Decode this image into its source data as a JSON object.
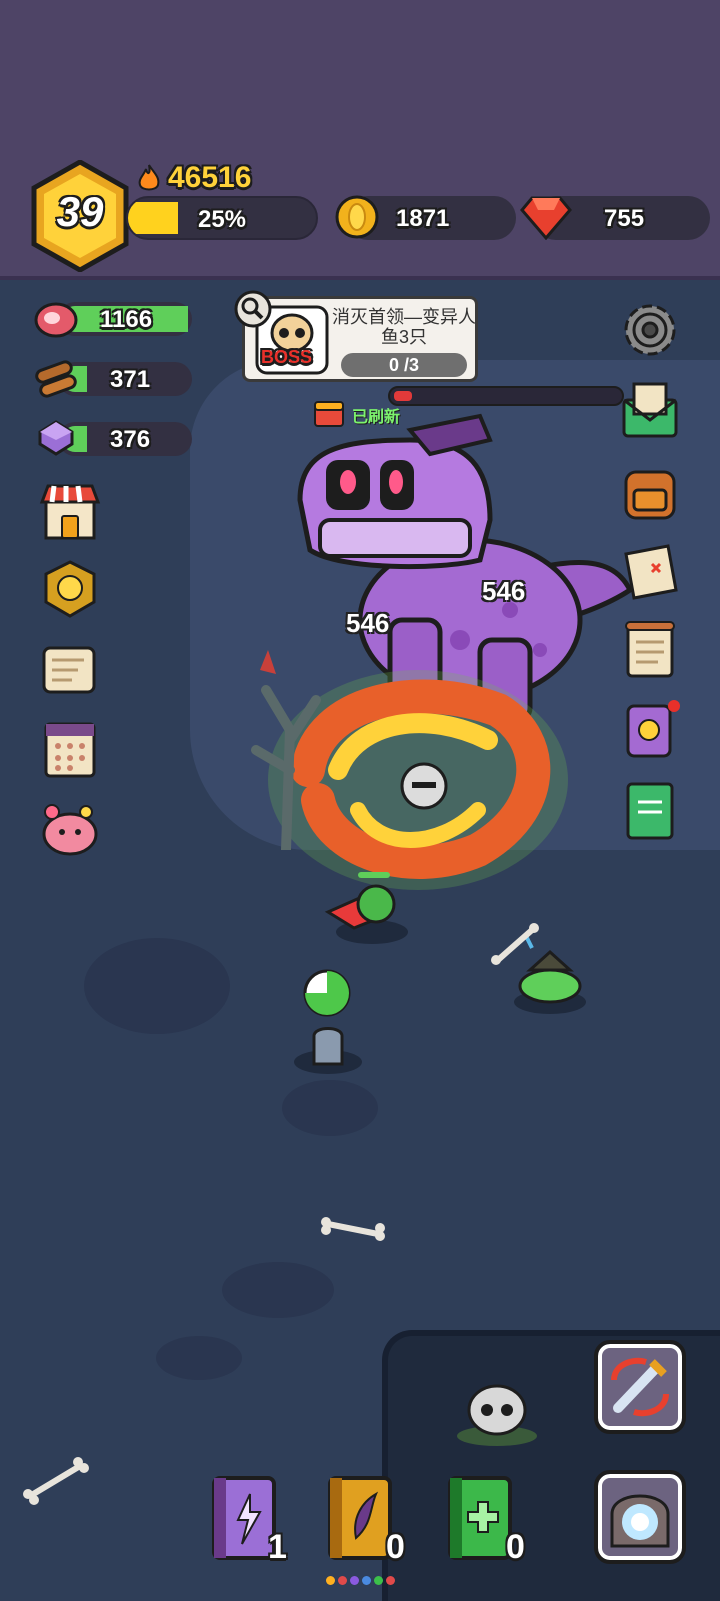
{
  "player": {
    "level": "39",
    "power": "46516",
    "xp_percent_label": "25%",
    "xp_progress": 0.25
  },
  "currencies": {
    "gold": "1871",
    "gems": "755"
  },
  "resources": [
    {
      "name": "meat-icon",
      "value": "1166",
      "fill": 1.0
    },
    {
      "name": "wood-icon",
      "value": "371",
      "fill": 0.2
    },
    {
      "name": "crystal-icon",
      "value": "376",
      "fill": 0.2
    }
  ],
  "boss_quest": {
    "badge": "BOSS",
    "title": "消灭首领—变异人鱼3只",
    "progress": "0 /3"
  },
  "refresh_label": "已刷新",
  "boss_hp_fraction": 0.08,
  "damage_numbers": [
    "546",
    "546"
  ],
  "left_menu": [
    "shop-icon",
    "rank-badge-icon",
    "quest-scroll-icon",
    "calendar-icon",
    "pet-icon"
  ],
  "right_menu": [
    "settings-icon",
    "mail-icon",
    "backpack-icon",
    "treasure-map-icon",
    "task-board-icon",
    "boss-card-icon",
    "guide-book-icon"
  ],
  "skill_books": [
    {
      "name": "lightning-book",
      "count": "1",
      "color": "#9b6fd6"
    },
    {
      "name": "wind-book",
      "count": "0",
      "color": "#e0a020"
    },
    {
      "name": "heal-book",
      "count": "0",
      "color": "#3cb84a"
    }
  ],
  "dot_colors": [
    "#ffb020",
    "#e04a4a",
    "#8a5ae0",
    "#4a8ae0",
    "#3cc04a",
    "#e04a4a"
  ],
  "colors": {
    "top_bg": "#4e4466",
    "map_bg": "#2f3e58",
    "xp_fill": "#ffd21e",
    "power_text": "#ffd23a",
    "refresh_text": "#7cf26d"
  }
}
